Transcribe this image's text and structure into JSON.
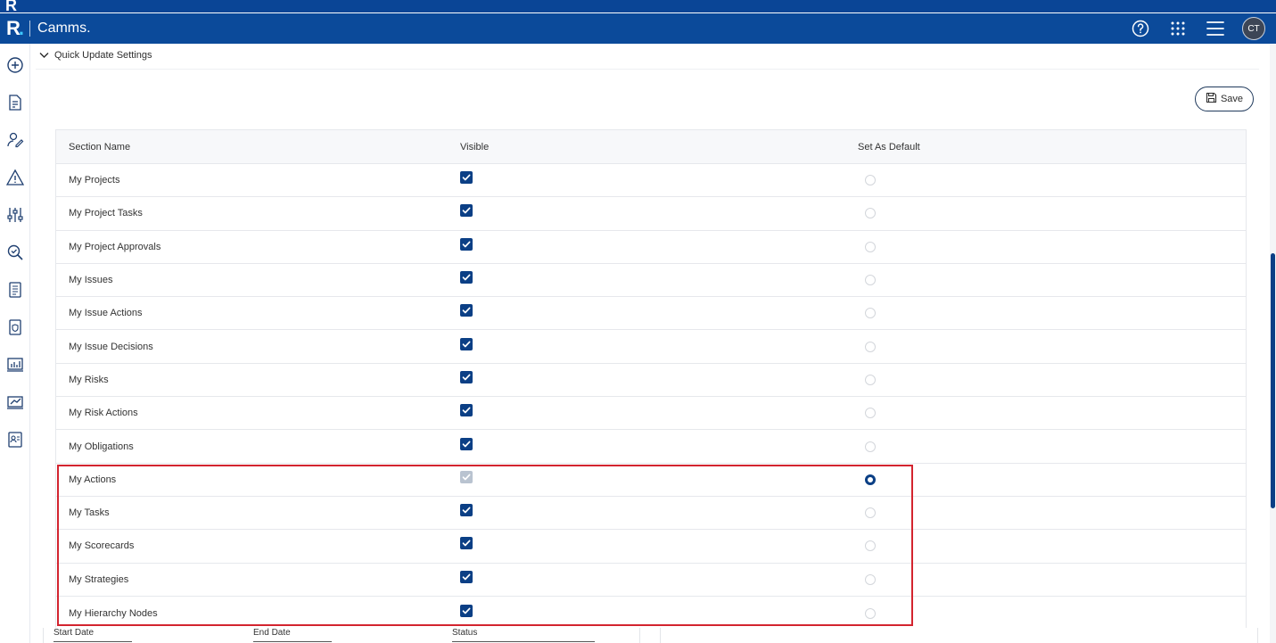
{
  "header": {
    "logo_letter": "R",
    "logo_dot": ".",
    "brand": "Camms.",
    "avatar_initials": "CT",
    "icons": [
      "help-icon",
      "apps-grid-icon",
      "menu-icon"
    ]
  },
  "sidebar": {
    "icons": [
      "add-icon",
      "document-edit-icon",
      "user-edit-icon",
      "warning-icon",
      "sliders-icon",
      "search-check-icon",
      "document-list-icon",
      "shield-document-icon",
      "bar-chart-icon",
      "trend-chart-icon",
      "id-card-icon"
    ]
  },
  "section": {
    "title": "Quick Update Settings",
    "save_label": "Save"
  },
  "table": {
    "headers": {
      "name": "Section Name",
      "visible": "Visible",
      "default": "Set As Default"
    },
    "rows": [
      {
        "name": "My Projects",
        "visible": true,
        "visible_disabled": false,
        "is_default": false
      },
      {
        "name": "My Project Tasks",
        "visible": true,
        "visible_disabled": false,
        "is_default": false
      },
      {
        "name": "My Project Approvals",
        "visible": true,
        "visible_disabled": false,
        "is_default": false
      },
      {
        "name": "My Issues",
        "visible": true,
        "visible_disabled": false,
        "is_default": false
      },
      {
        "name": "My Issue Actions",
        "visible": true,
        "visible_disabled": false,
        "is_default": false
      },
      {
        "name": "My Issue Decisions",
        "visible": true,
        "visible_disabled": false,
        "is_default": false
      },
      {
        "name": "My Risks",
        "visible": true,
        "visible_disabled": false,
        "is_default": false
      },
      {
        "name": "My Risk Actions",
        "visible": true,
        "visible_disabled": false,
        "is_default": false
      },
      {
        "name": "My Obligations",
        "visible": true,
        "visible_disabled": false,
        "is_default": false
      },
      {
        "name": "My Actions",
        "visible": true,
        "visible_disabled": true,
        "is_default": true
      },
      {
        "name": "My Tasks",
        "visible": true,
        "visible_disabled": false,
        "is_default": false
      },
      {
        "name": "My Scorecards",
        "visible": true,
        "visible_disabled": false,
        "is_default": false
      },
      {
        "name": "My Strategies",
        "visible": true,
        "visible_disabled": false,
        "is_default": false
      },
      {
        "name": "My Hierarchy Nodes",
        "visible": true,
        "visible_disabled": false,
        "is_default": false
      }
    ]
  },
  "filters": {
    "start_date_label": "Start Date",
    "end_date_label": "End Date",
    "status_label": "Status"
  },
  "colors": {
    "header_bg": "#0b4a9a",
    "accent": "#0b3f85",
    "highlight": "#d3242f"
  }
}
